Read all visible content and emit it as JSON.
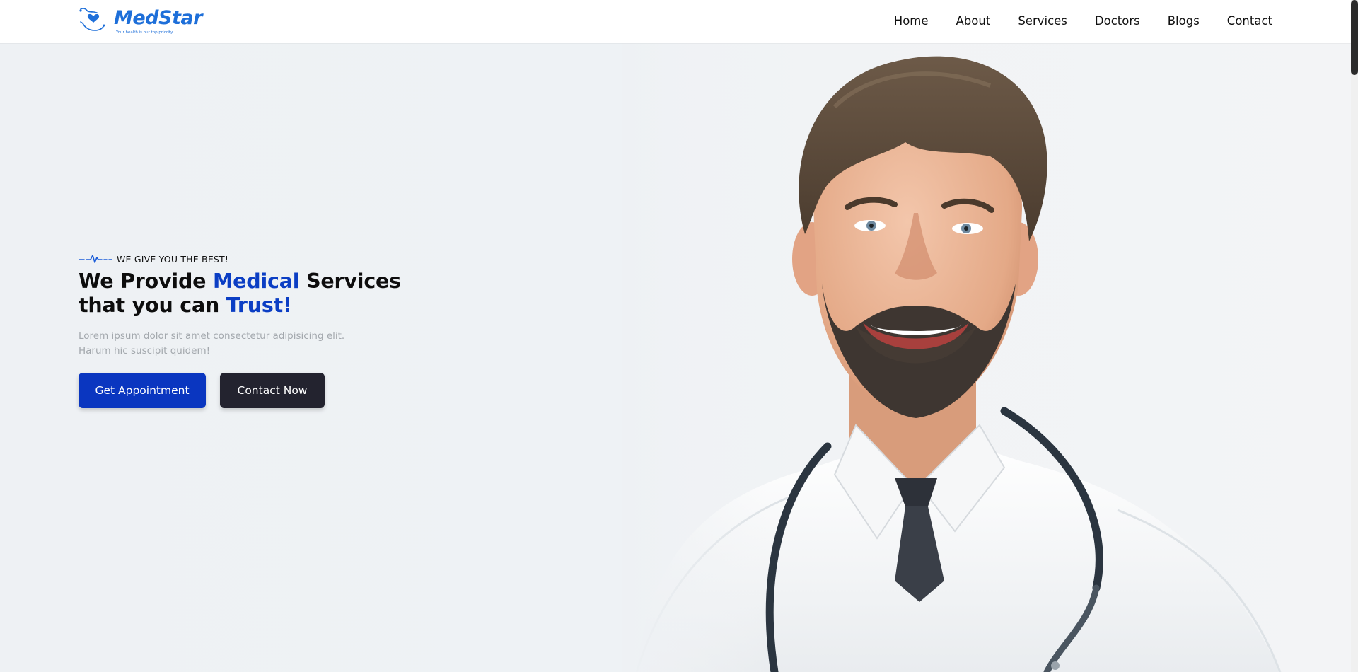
{
  "brand": {
    "name": "MedStar",
    "tagline": "Your health is our top priority",
    "logo_icon": "heart-in-hands-icon",
    "color": "#1e6fd9"
  },
  "nav": {
    "items": [
      {
        "label": "Home"
      },
      {
        "label": "About"
      },
      {
        "label": "Services"
      },
      {
        "label": "Doctors"
      },
      {
        "label": "Blogs"
      },
      {
        "label": "Contact"
      }
    ]
  },
  "hero": {
    "eyebrow_icon": "heartbeat-pulse-icon",
    "eyebrow": "WE GIVE YOU THE BEST!",
    "headline": {
      "part1": "We Provide ",
      "accent1": "Medical",
      "part2": " Services",
      "part3": "that you can ",
      "accent2": "Trust!"
    },
    "description": "Lorem ipsum dolor sit amet consectetur adipisicing elit. Harum hic suscipit quidem!",
    "primary_button": "Get Appointment",
    "secondary_button": "Contact Now",
    "image": "smiling-doctor-with-stethoscope"
  },
  "colors": {
    "accent": "#0b3ec4",
    "primary_button": "#0a36c0",
    "dark_button": "#23232f",
    "hero_background": "#eef1f4",
    "muted_text": "#a3a8ad"
  }
}
